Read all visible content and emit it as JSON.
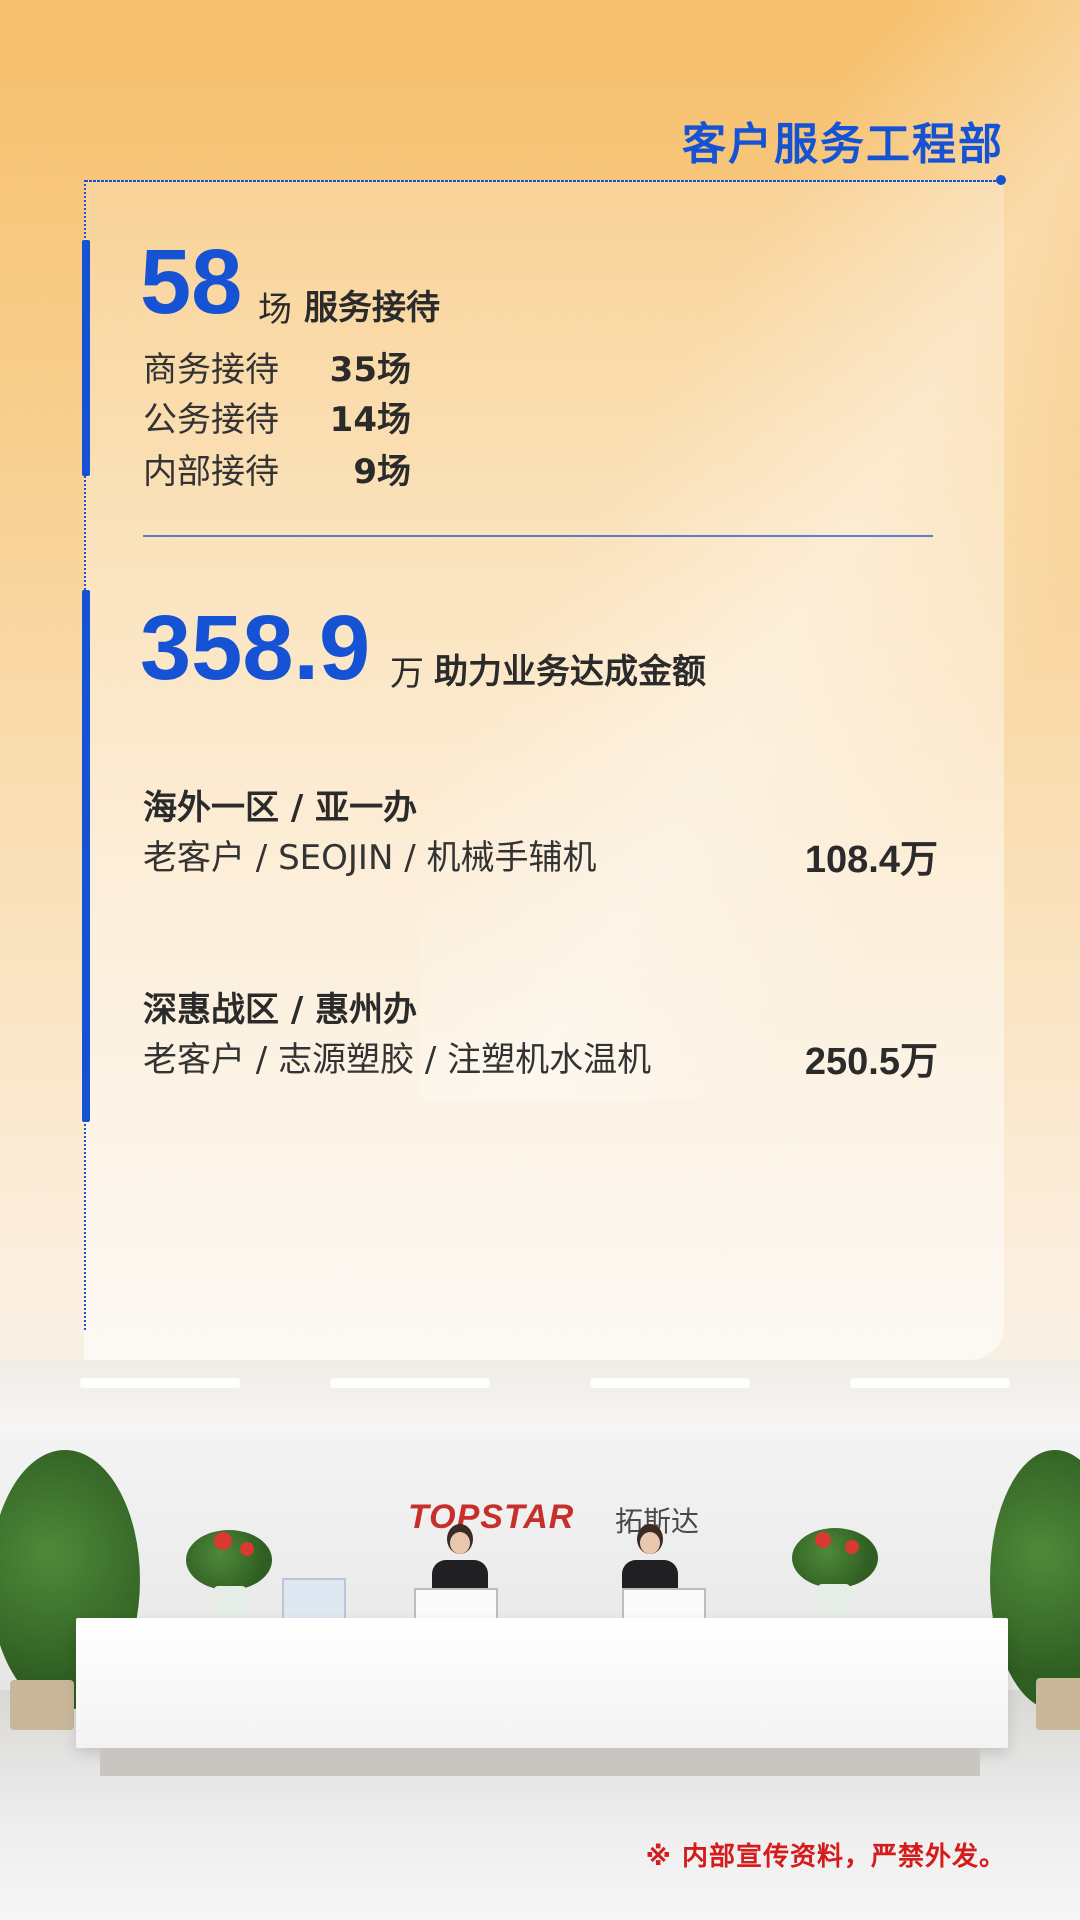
{
  "header": {
    "department": "客户服务工程部"
  },
  "reception": {
    "total": "58",
    "unit": "场",
    "label": "服务接待",
    "items": [
      {
        "label": "商务接待",
        "value": "35场"
      },
      {
        "label": "公务接待",
        "value": "14场"
      },
      {
        "label": "内部接待",
        "value": "9场"
      }
    ]
  },
  "deals": {
    "total": "358.9",
    "unit": "万",
    "label": "助力业务达成金额",
    "cases": [
      {
        "region": "海外一区 / 亚一办",
        "detail": "老客户 / SEOJIN / 机械手辅机",
        "amount": "108.4万"
      },
      {
        "region": "深惠战区 / 惠州办",
        "detail": "老客户 / 志源塑胶 / 注塑机水温机",
        "amount": "250.5万"
      }
    ]
  },
  "photo": {
    "logo_en": "TOPSTAR",
    "logo_cn": "拓斯达"
  },
  "footer": {
    "notice": "※ 内部宣传资料，严禁外发。"
  },
  "colors": {
    "accent": "#1553d4",
    "warning": "#d51b1b",
    "background_top": "#f6bf6b"
  }
}
